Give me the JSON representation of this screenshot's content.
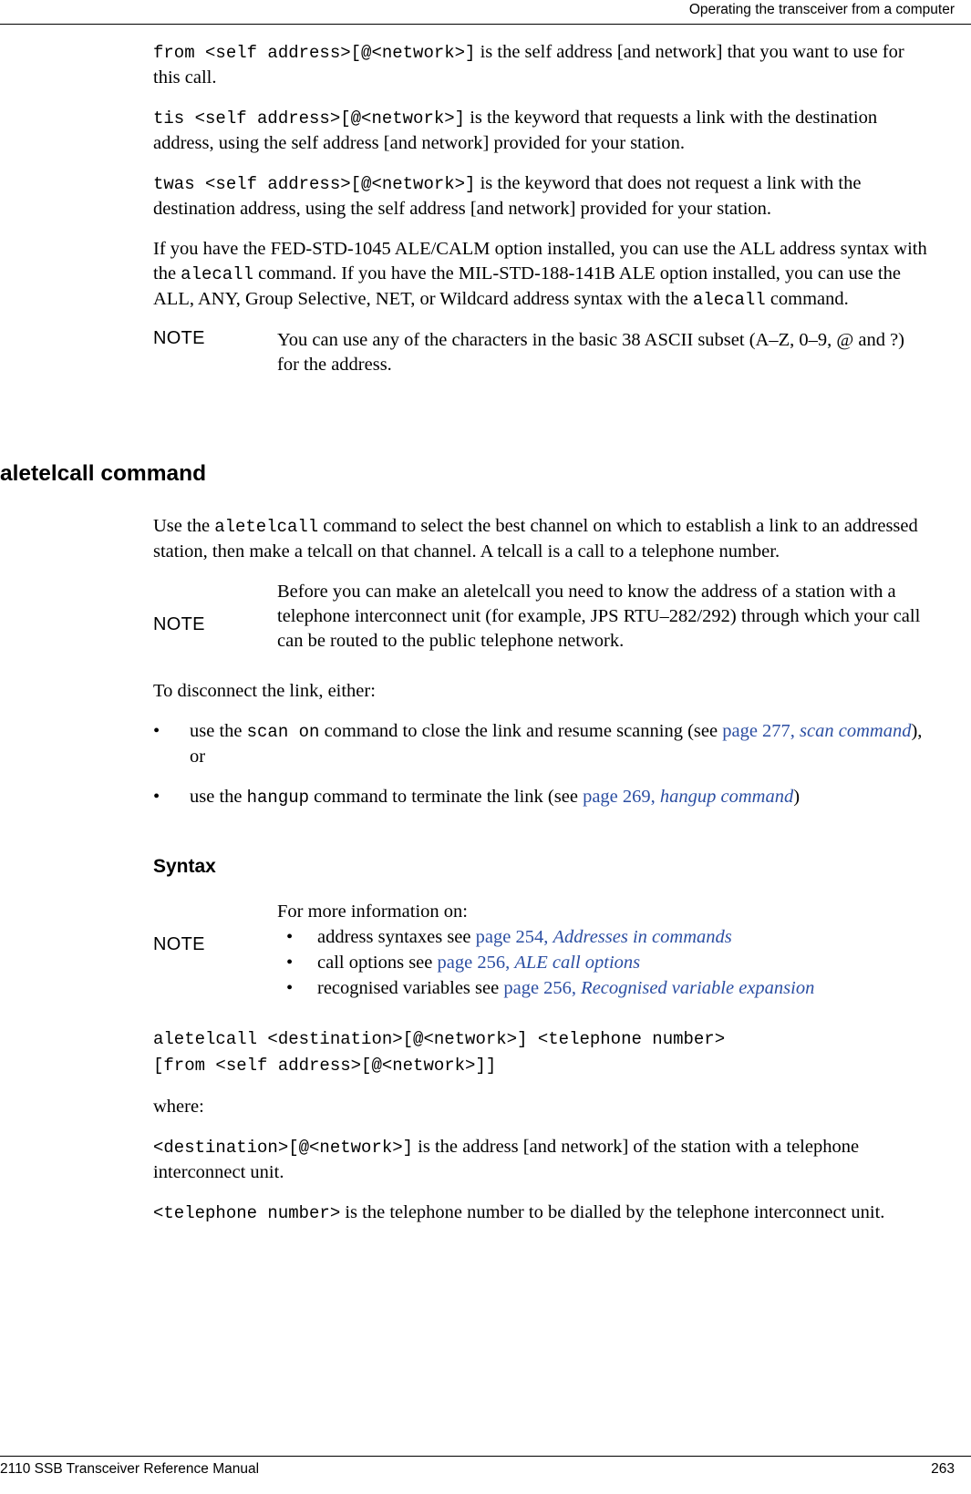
{
  "header": {
    "title": "Operating the transceiver from a computer"
  },
  "footer": {
    "manual": "2110 SSB Transceiver Reference Manual",
    "page_number": "263"
  },
  "content": {
    "para_from": {
      "code": "from <self address>[@<network>]",
      "text": " is the self address [and network] that you want to use for this call."
    },
    "para_tis": {
      "code": "tis <self address>[@<network>]",
      "text": " is the keyword that requests a link with the destination address, using the self address [and network] provided for your station."
    },
    "para_twas": {
      "code": "twas <self address>[@<network>]",
      "text": " is the keyword that does not request a link with the destination address, using the self address [and network] provided for your station."
    },
    "para_fed": {
      "t1": "If you have the FED-STD-1045 ALE/CALM option installed, you can use the ALL address syntax with the ",
      "c1": "alecall",
      "t2": " command. If you have the MIL-STD-188-141B ALE option installed, you can use the ALL, ANY, Group Selective, NET, or Wildcard address syntax with the ",
      "c2": "alecall",
      "t3": " command."
    },
    "note1": {
      "label": "NOTE",
      "text": "You can use any of the characters in the basic 38 ASCII subset (A–Z, 0–9, @ and ?) for the address."
    },
    "heading_aletelcall": "aletelcall command",
    "para_use": {
      "t1": "Use the ",
      "c1": "aletelcall",
      "t2": " command to select the best channel on which to establish a link to an addressed station, then make a telcall on that channel. A telcall is a call to a telephone number."
    },
    "note2": {
      "label": "NOTE",
      "text": "Before you can make an aletelcall you need to know the address of a station with a telephone interconnect unit (for example, JPS RTU–282/292) through which your call can be routed to the public telephone network."
    },
    "para_disconnect": "To disconnect the link, either:",
    "bullets": [
      {
        "dot": "•",
        "t1": "use the ",
        "c1": "scan on",
        "t2": " command to close the link and resume scanning (see ",
        "link": "page 277,",
        "link_ital": "scan command",
        "t3": "), or"
      },
      {
        "dot": "•",
        "t1": "use the ",
        "c1": "hangup",
        "t2": " command to terminate the link (see ",
        "link": "page 269,",
        "link_ital": "hangup command",
        "t3": ")"
      }
    ],
    "heading_syntax": "Syntax",
    "note3": {
      "label": "NOTE",
      "intro": "For more information on:",
      "items": [
        {
          "dot": "•",
          "text": "address syntaxes see ",
          "link": "page 254,",
          "link_ital": "Addresses in commands"
        },
        {
          "dot": "•",
          "text": "call options see ",
          "link": "page 256,",
          "link_ital": "ALE call options"
        },
        {
          "dot": "•",
          "text": "recognised variables see ",
          "link": "page 256,",
          "link_ital": "Recognised variable expansion"
        }
      ]
    },
    "syntax_code_line1": "aletelcall <destination>[@<network>] <telephone number>",
    "syntax_code_line2": "[from <self address>[@<network>]]",
    "where_label": "where:",
    "para_dest": {
      "code": "<destination>[@<network>]",
      "text": " is the address [and network] of the station with a telephone interconnect unit."
    },
    "para_tel": {
      "code": "<telephone number>",
      "text": " is the telephone number to be dialled by the telephone interconnect unit."
    }
  }
}
